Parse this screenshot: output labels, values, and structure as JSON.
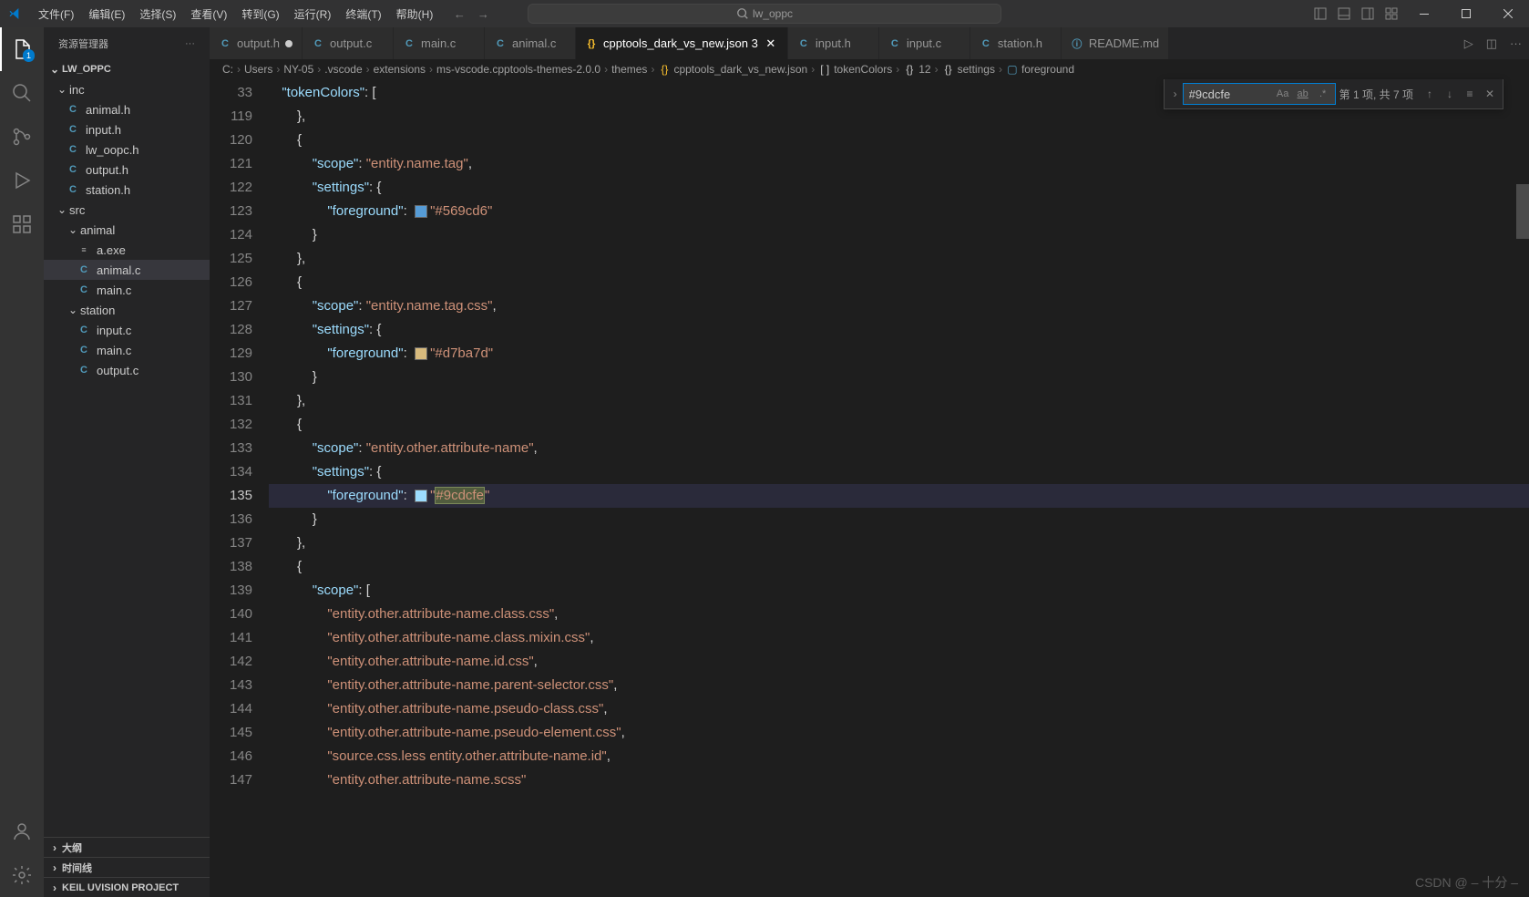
{
  "titlebar": {
    "menus": [
      "文件(F)",
      "编辑(E)",
      "选择(S)",
      "查看(V)",
      "转到(G)",
      "运行(R)",
      "终端(T)",
      "帮助(H)"
    ],
    "search_placeholder": "lw_oppc"
  },
  "sidebar": {
    "title": "资源管理器",
    "project": "LW_OPPC",
    "tree": {
      "inc": [
        {
          "icon": "C",
          "name": "animal.h"
        },
        {
          "icon": "C",
          "name": "input.h"
        },
        {
          "icon": "C",
          "name": "lw_oopc.h"
        },
        {
          "icon": "C",
          "name": "output.h"
        },
        {
          "icon": "C",
          "name": "station.h"
        }
      ],
      "src": {
        "animal": [
          {
            "icon": "exe",
            "name": "a.exe"
          },
          {
            "icon": "C",
            "name": "animal.c"
          },
          {
            "icon": "C",
            "name": "main.c"
          }
        ],
        "station": [
          {
            "icon": "C",
            "name": "input.c"
          },
          {
            "icon": "C",
            "name": "main.c"
          },
          {
            "icon": "C",
            "name": "output.c"
          }
        ]
      }
    },
    "sections": {
      "outline": "大纲",
      "timeline": "时间线",
      "keil": "KEIL UVISION PROJECT"
    }
  },
  "tabs": [
    {
      "icon": "C",
      "label": "output.h",
      "dirty": true
    },
    {
      "icon": "C",
      "label": "output.c"
    },
    {
      "icon": "C",
      "label": "main.c"
    },
    {
      "icon": "C",
      "label": "animal.c"
    },
    {
      "icon": "{}",
      "label": "cpptools_dark_vs_new.json 3",
      "active": true,
      "close": true
    },
    {
      "icon": "C",
      "label": "input.h"
    },
    {
      "icon": "C",
      "label": "input.c"
    },
    {
      "icon": "C",
      "label": "station.h"
    },
    {
      "icon": "ⓘ",
      "label": "README.md"
    }
  ],
  "breadcrumbs": [
    "C:",
    "Users",
    "NY-05",
    ".vscode",
    "extensions",
    "ms-vscode.cpptools-themes-2.0.0",
    "themes",
    "cpptools_dark_vs_new.json",
    "tokenColors",
    "12",
    "settings",
    "foreground"
  ],
  "breadcrumb_icons": {
    "json": "{}",
    "array": "[ ]",
    "num": "{}",
    "obj": "{}",
    "str": "▢"
  },
  "find": {
    "value": "#9cdcfe",
    "results": "第 1 项, 共 7 项"
  },
  "gutter": [
    "33",
    "119",
    "120",
    "121",
    "122",
    "123",
    "124",
    "125",
    "126",
    "127",
    "128",
    "129",
    "130",
    "131",
    "132",
    "133",
    "134",
    "135",
    "136",
    "137",
    "138",
    "139",
    "140",
    "141",
    "142",
    "143",
    "144",
    "145",
    "146",
    "147"
  ],
  "code": {
    "l33": {
      "key": "tokenColors",
      "punc": ": ["
    },
    "scope": "scope",
    "settings": "settings",
    "foreground": "foreground",
    "v121": "entity.name.tag",
    "v123": "#569cd6",
    "v127": "entity.name.tag.css",
    "v129": "#d7ba7d",
    "v133": "entity.other.attribute-name",
    "v135": "#9cdcfe",
    "v140": "entity.other.attribute-name.class.css",
    "v141": "entity.other.attribute-name.class.mixin.css",
    "v142": "entity.other.attribute-name.id.css",
    "v143": "entity.other.attribute-name.parent-selector.css",
    "v144": "entity.other.attribute-name.pseudo-class.css",
    "v145": "entity.other.attribute-name.pseudo-element.css",
    "v146": "source.css.less entity.other.attribute-name.id",
    "v147": "entity.other.attribute-name.scss"
  },
  "watermark": "CSDN @ – 十分 –"
}
